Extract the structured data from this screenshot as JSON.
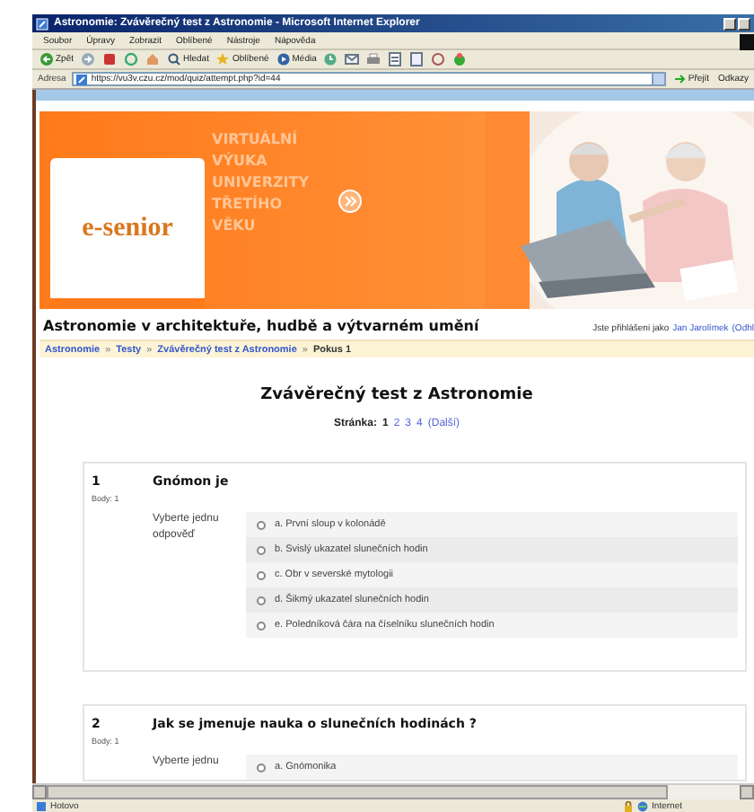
{
  "window": {
    "title": "Astronomie: Zvávěrečný test z Astronomie - Microsoft Internet Explorer"
  },
  "menu": [
    "Soubor",
    "Úpravy",
    "Zobrazit",
    "Oblíbené",
    "Nástroje",
    "Nápověda"
  ],
  "toolbar": [
    {
      "kind": "back",
      "label": "Zpět"
    },
    {
      "kind": "forward"
    },
    {
      "kind": "stop"
    },
    {
      "kind": "refresh"
    },
    {
      "kind": "home"
    },
    {
      "kind": "search",
      "label": "Hledat"
    },
    {
      "kind": "favorites",
      "label": "Oblíbené"
    },
    {
      "kind": "media",
      "label": "Média"
    },
    {
      "kind": "history"
    },
    {
      "kind": "mail"
    },
    {
      "kind": "print"
    },
    {
      "kind": "edit"
    },
    {
      "kind": "discuss"
    },
    {
      "kind": "messenger"
    },
    {
      "kind": "extra"
    }
  ],
  "address": {
    "label": "Adresa",
    "url": "https://vu3v.czu.cz/mod/quiz/attempt.php?id=44",
    "go": "Přejít",
    "links": "Odkazy"
  },
  "banner": {
    "logo": "e-senior",
    "tagline": [
      "VIRTUÁLNÍ",
      "VÝUKA",
      "UNIVERZITY",
      "TŘETÍHO",
      "VĚKU"
    ]
  },
  "course_title": "Astronomie v architektuře, hudbě a výtvarném umění",
  "login": {
    "prefix": "Jste přihlášeni jako",
    "user": "Jan Jarolímek",
    "logout": "(Odhl"
  },
  "breadcrumb_separator": "»",
  "breadcrumb": [
    {
      "kind": "link",
      "label": "Astronomie"
    },
    {
      "kind": "link",
      "label": "Testy"
    },
    {
      "kind": "link",
      "label": "Zvávěrečný test z Astronomie"
    },
    {
      "kind": "current",
      "label": "Pokus 1"
    }
  ],
  "quiz_title": "Zvávěrečný test z Astronomie",
  "pages": {
    "label": "Stránka:",
    "items": [
      {
        "label": "1",
        "selected": true
      },
      {
        "label": "2",
        "selected": false
      },
      {
        "label": "3",
        "selected": false
      },
      {
        "label": "4",
        "selected": false
      }
    ],
    "next": "(Další)"
  },
  "questions": [
    {
      "number": "1",
      "text": "Gnómon je",
      "points": "Body: 1",
      "prompt": "Vyberte jednu odpověď",
      "options": [
        {
          "label": "a. První sloup v kolonádě",
          "selected": false
        },
        {
          "label": "b. Svislý ukazatel slunečních hodin",
          "selected": false
        },
        {
          "label": "c. Obr v severské mytologii",
          "selected": false
        },
        {
          "label": "d. Šikmý ukazatel slunečních hodin",
          "selected": false
        },
        {
          "label": "e. Poledníková čára na číselníku slunečních hodin",
          "selected": false
        }
      ]
    },
    {
      "number": "2",
      "text": "Jak se jmenuje nauka o slunečních hodinách ?",
      "points": "Body: 1",
      "prompt": "Vyberte jednu",
      "options": [
        {
          "label": "a. Gnómonika",
          "selected": false
        }
      ]
    }
  ],
  "status": {
    "text": "Hotovo",
    "zone": "Internet"
  }
}
